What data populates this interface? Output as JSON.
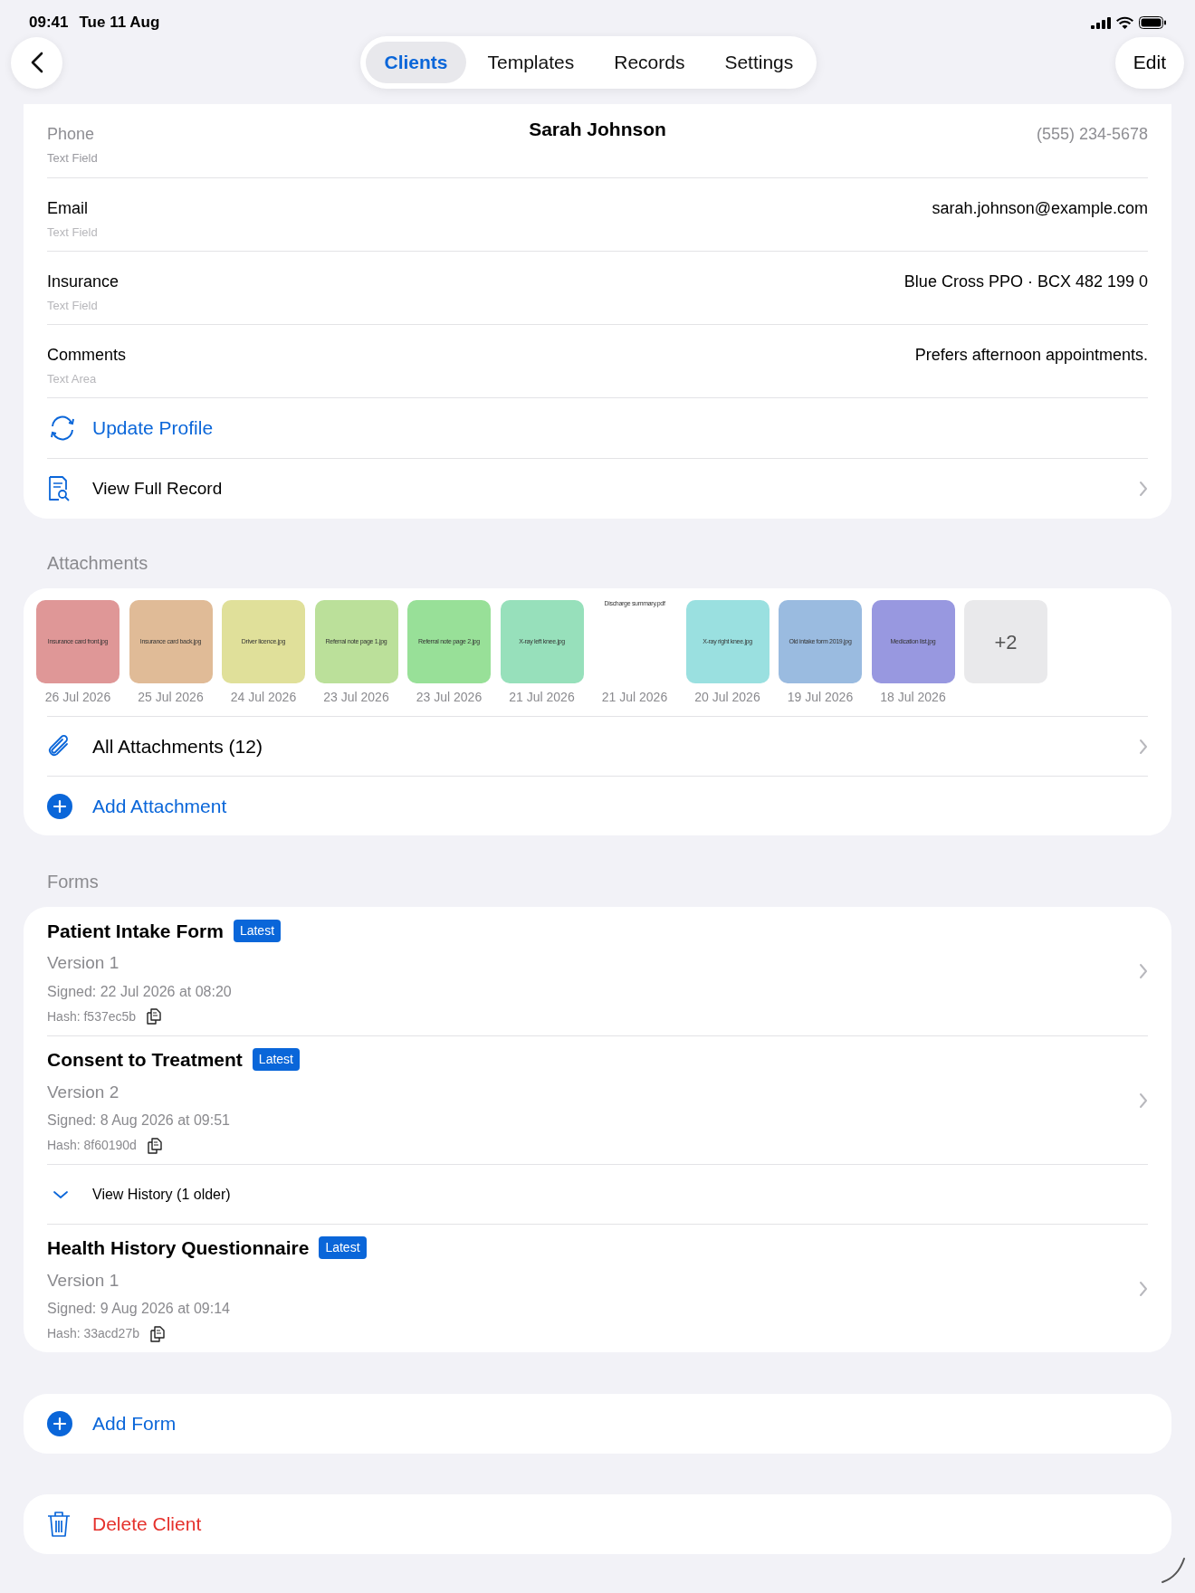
{
  "status_bar": {
    "time": "09:41",
    "date": "Tue 11 Aug"
  },
  "nav": {
    "tabs": [
      {
        "label": "Clients",
        "selected": true
      },
      {
        "label": "Templates",
        "selected": false
      },
      {
        "label": "Records",
        "selected": false
      },
      {
        "label": "Settings",
        "selected": false
      }
    ],
    "edit": "Edit"
  },
  "client": {
    "name": "Sarah Johnson",
    "fields": [
      {
        "label": "Phone",
        "type": "Text Field",
        "value": "(555) 234-5678",
        "faded": true
      },
      {
        "label": "Email",
        "type": "Text Field",
        "value": "sarah.johnson@example.com",
        "faded": false
      },
      {
        "label": "Insurance",
        "type": "Text Field",
        "value": "Blue Cross PPO · BCX 482 199 0",
        "faded": false
      },
      {
        "label": "Comments",
        "type": "Text Area",
        "value": "Prefers afternoon appointments.",
        "faded": false
      }
    ],
    "actions": [
      {
        "kind": "update",
        "label": "Update Profile"
      },
      {
        "kind": "record",
        "label": "View Full Record"
      }
    ]
  },
  "attachments": {
    "title": "Attachments",
    "items": [
      {
        "kind": "image",
        "name": "Insurance card front.jpg",
        "date": "26 Jul 2026",
        "color": "#df9797"
      },
      {
        "kind": "image",
        "name": "Insurance card back.jpg",
        "date": "25 Jul 2026",
        "color": "#e0bb97"
      },
      {
        "kind": "image",
        "name": "Driver licence.jpg",
        "date": "24 Jul 2026",
        "color": "#e0e09a"
      },
      {
        "kind": "image",
        "name": "Referral note page 1.jpg",
        "date": "23 Jul 2026",
        "color": "#bbe09a"
      },
      {
        "kind": "image",
        "name": "Referral note page 2.jpg",
        "date": "23 Jul 2026",
        "color": "#98e098"
      },
      {
        "kind": "image",
        "name": "X-ray left knee.jpg",
        "date": "21 Jul 2026",
        "color": "#97e0bb"
      },
      {
        "kind": "pdf",
        "name": "Discharge summary.pdf",
        "date": "21 Jul 2026"
      },
      {
        "kind": "image",
        "name": "X-ray right knee.jpg",
        "date": "20 Jul 2026",
        "color": "#9ae0e0"
      },
      {
        "kind": "image",
        "name": "Old intake form 2019.jpg",
        "date": "19 Jul 2026",
        "color": "#9abbe0"
      },
      {
        "kind": "image",
        "name": "Medication list.jpg",
        "date": "18 Jul 2026",
        "color": "#9898e0"
      },
      {
        "kind": "more",
        "name": "+2"
      }
    ],
    "all": "All Attachments (12)",
    "add": "Add Attachment"
  },
  "forms": {
    "title": "Forms",
    "items": [
      {
        "kind": "form",
        "title": "Patient Intake Form",
        "badge": "Latest",
        "version": "Version 1",
        "signed": "Signed: 22 Jul 2026 at 08:20",
        "hash": "Hash: f537ec5b"
      },
      {
        "kind": "form",
        "title": "Consent to Treatment",
        "badge": "Latest",
        "version": "Version 2",
        "signed": "Signed: 8 Aug 2026 at 09:51",
        "hash": "Hash: 8f60190d"
      },
      {
        "kind": "history",
        "label": "View History (1 older)",
        "expanded": false
      },
      {
        "kind": "form",
        "title": "Health History Questionnaire",
        "badge": "Latest",
        "version": "Version 1",
        "signed": "Signed: 9 Aug 2026 at 09:14",
        "hash": "Hash: 33acd27b"
      }
    ]
  },
  "add_form": "Add Form",
  "delete_client": "Delete Client"
}
